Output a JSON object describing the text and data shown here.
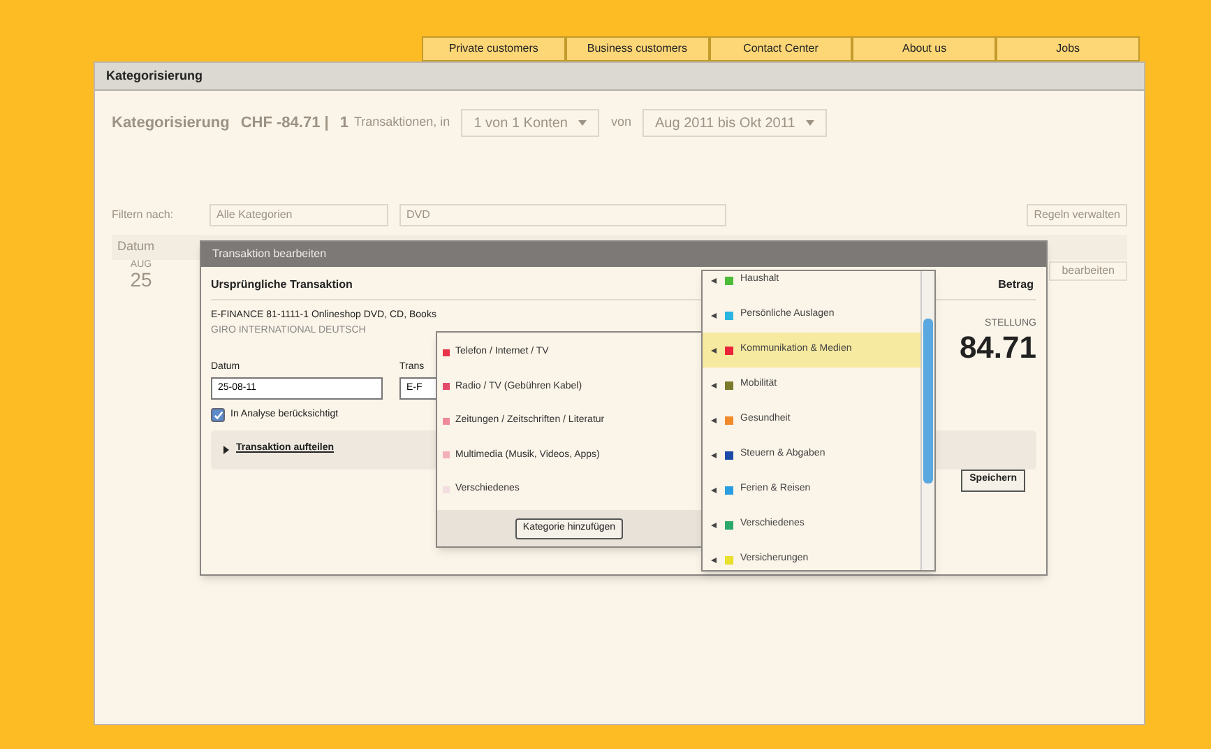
{
  "nav_tabs": [
    "Private customers",
    "Business customers",
    "Contact Center",
    "About us",
    "Jobs"
  ],
  "window": {
    "title": "Kategorisierung"
  },
  "summary": {
    "title": "Kategorisierung",
    "amount": "CHF -84.71 |",
    "count": "1",
    "count_label": "Transaktionen, in",
    "accounts": "1 von 1 Konten",
    "from_label": "von",
    "period": "Aug 2011 bis Okt 2011"
  },
  "filter": {
    "label": "Filtern nach:",
    "category": "Alle Kategorien",
    "search": "DVD",
    "rules_button": "Regeln verwalten"
  },
  "table": {
    "column_1": "Datum",
    "rows": [
      {
        "month": "AUG",
        "day": "25",
        "action": "bearbeiten"
      }
    ]
  },
  "dialog": {
    "title": "Transaktion bearbeiten",
    "section_title": "Ursprüngliche Transaktion",
    "amount_header": "Betrag",
    "description": "E-FINANCE 81-1111-1 Onlineshop DVD, CD, Books",
    "sender": "GIRO INTERNATIONAL DEUTSCH",
    "category_label": "STELLUNG",
    "amount": "84.71",
    "date_label": "Datum",
    "date_value": "25-08-11",
    "type_label": "Trans",
    "type_value": "E-F",
    "include": {
      "label": "In Analyse berücksichtigt",
      "checked": true
    },
    "split_link": "Transaktion aufteilen",
    "save_button": "Speichern"
  },
  "submenu": {
    "items": [
      {
        "label": "Telefon / Internet / TV",
        "color": "#e8334a"
      },
      {
        "label": "Radio / TV (Gebühren Kabel)",
        "color": "#e44a6a"
      },
      {
        "label": "Zeitungen / Zeitschriften / Literatur",
        "color": "#ef8a9a"
      },
      {
        "label": "Multimedia (Musik, Videos, Apps)",
        "color": "#f4b0b8"
      },
      {
        "label": "Verschiedenes",
        "color": "#f2dde0"
      }
    ],
    "add_button": "Kategorie hinzufügen"
  },
  "category_list": {
    "items": [
      {
        "label": "Haushalt",
        "color": "#4cbb3a",
        "selected": false
      },
      {
        "label": "Persönliche Auslagen",
        "color": "#2ab6e0",
        "selected": false
      },
      {
        "label": "Kommunikation & Medien",
        "color": "#e8233a",
        "selected": true
      },
      {
        "label": "Mobilität",
        "color": "#7a7a2a",
        "selected": false
      },
      {
        "label": "Gesundheit",
        "color": "#f08a2a",
        "selected": false
      },
      {
        "label": "Steuern & Abgaben",
        "color": "#1c4aa8",
        "selected": false
      },
      {
        "label": "Ferien & Reisen",
        "color": "#2a9ee0",
        "selected": false
      },
      {
        "label": "Verschiedenes",
        "color": "#2aa86a",
        "selected": false
      },
      {
        "label": "Versicherungen",
        "color": "#e8e02a",
        "selected": false
      }
    ]
  }
}
